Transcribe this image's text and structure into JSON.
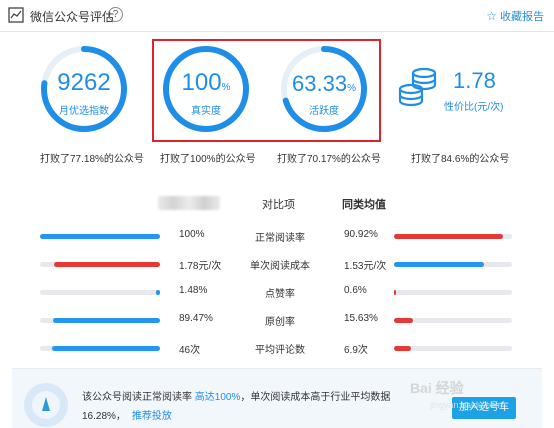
{
  "header": {
    "title": "微信公众号评估",
    "help": "?",
    "favorite_label": "收藏报告",
    "favorite_icon": "star-outline-icon"
  },
  "metrics": {
    "index": {
      "value": "9262",
      "unit": "",
      "label": "月优选指数",
      "percent": 77.18,
      "caption": "打败了77.18%的公众号"
    },
    "authenticity": {
      "value": "100",
      "unit": "%",
      "label": "真实度",
      "percent": 100,
      "caption": "打败了100%的公众号"
    },
    "activity": {
      "value": "63.33",
      "unit": "%",
      "label": "活跃度",
      "percent": 70.17,
      "caption": "打败了70.17%的公众号"
    },
    "price_ratio": {
      "value": "1.78",
      "label": "性价比(元/次)",
      "caption": "打败了84.6%的公众号",
      "icon": "coins-icon"
    }
  },
  "compare": {
    "col_item": "对比项",
    "col_avg": "同类均值",
    "rows": [
      {
        "item": "正常阅读率",
        "self_value": "100%",
        "avg_value": "90.92%",
        "self_frac": 1.0,
        "avg_frac": 0.92,
        "self_color": "#2196f3",
        "avg_color": "#e53935"
      },
      {
        "item": "单次阅读成本",
        "self_value": "1.78元/次",
        "avg_value": "1.53元/次",
        "self_frac": 0.88,
        "avg_frac": 0.76,
        "self_color": "#e53935",
        "avg_color": "#2196f3"
      },
      {
        "item": "点赞率",
        "self_value": "1.48%",
        "avg_value": "0.6%",
        "self_frac": 0.03,
        "avg_frac": 0.02,
        "self_color": "#2196f3",
        "avg_color": "#e53935"
      },
      {
        "item": "原创率",
        "self_value": "89.47%",
        "avg_value": "15.63%",
        "self_frac": 0.89,
        "avg_frac": 0.16,
        "self_color": "#2196f3",
        "avg_color": "#e53935"
      },
      {
        "item": "平均评论数",
        "self_value": "46次",
        "avg_value": "6.9次",
        "self_frac": 0.9,
        "avg_frac": 0.14,
        "self_color": "#2196f3",
        "avg_color": "#e53935"
      }
    ]
  },
  "bottom": {
    "msg_prefix": "该公众号阅读正常阅读率",
    "msg_highlight": "高达100%",
    "msg_suffix": "，单次阅读成本高于行业平均数据",
    "msg2": "16.28%，",
    "link": "推荐投放",
    "button": "加入选号车"
  },
  "watermark": {
    "text": "Bai 经验",
    "url": "jingyan.baidu.com"
  },
  "colors": {
    "accent": "#1f8ee8",
    "danger": "#e53935",
    "track": "#e6e8ec"
  }
}
